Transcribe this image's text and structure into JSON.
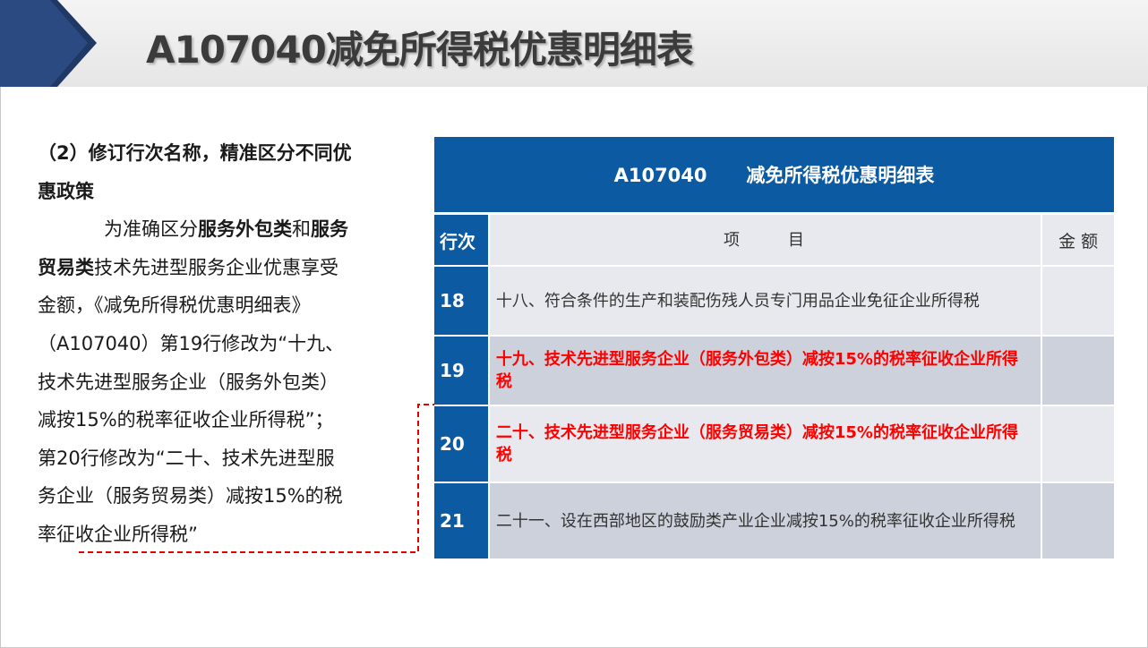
{
  "title": "A107040减免所得税优惠明细表",
  "left_text": {
    "l1": "（2）修订行次名称，精准区分不同优",
    "l2": "惠政策",
    "l3_a": "为准确区分",
    "l3_b": "服务外包类",
    "l3_c": "和",
    "l3_d": "服务",
    "l4_a": "贸易类",
    "l4_b": "技术先进型服务企业优惠享受",
    "l5": "金额，《减免所得税优惠明细表》",
    "l6": "（A107040）第19行修改为“十九、",
    "l7": "技术先进型服务企业（服务外包类）",
    "l8": "减按15%的税率征收企业所得税”；",
    "l9": "第20行修改为“二十、技术先进型服",
    "l10": "务企业（服务贸易类）减按15%的税",
    "l11": "率征收企业所得税”"
  },
  "table": {
    "header": "A107040      减免所得税优惠明细表",
    "col_row": "行次",
    "col_item": "项　　　目",
    "col_amount": "金 额",
    "rows": [
      {
        "num": "18",
        "text": "十八、符合条件的生产和装配伤残人员专门用品企业免征企业所得税",
        "amount": ""
      },
      {
        "num": "19",
        "text": "十九、技术先进型服务企业（服务外包类）减按15%的税率征收企业所得税",
        "amount": ""
      },
      {
        "num": "20",
        "text": "二十、技术先进型服务企业（服务贸易类）减按15%的税率征收企业所得税",
        "amount": ""
      },
      {
        "num": "21",
        "text": "二十一、设在西部地区的鼓励类产业企业减按15%的税率征收企业所得税",
        "amount": ""
      }
    ]
  },
  "colors": {
    "table_blue": "#0b5aa2",
    "title_arrow": "#1f3864",
    "highlight_red": "#ff0000"
  }
}
